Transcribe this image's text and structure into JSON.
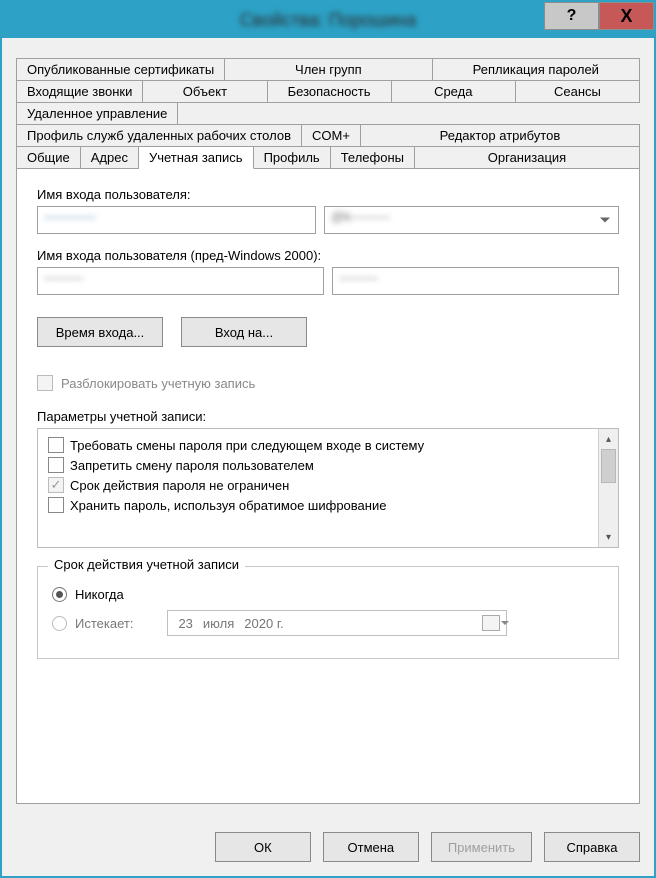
{
  "titlebar": {
    "title": "Свойства: Порошина",
    "help": "?",
    "close": "X"
  },
  "tabs": {
    "row1": [
      "Опубликованные сертификаты",
      "Член групп",
      "Репликация паролей"
    ],
    "row2": [
      "Входящие звонки",
      "Объект",
      "Безопасность",
      "Среда",
      "Сеансы"
    ],
    "row3": [
      "Удаленное управление"
    ],
    "row4": [
      "Профиль служб удаленных рабочих столов",
      "COM+",
      "Редактор атрибутов"
    ],
    "row5": [
      "Общие",
      "Адрес",
      "Учетная запись",
      "Профиль",
      "Телефоны",
      "Организация"
    ],
    "active": "Учетная запись"
  },
  "account": {
    "logon_label": "Имя входа пользователя:",
    "logon_value": "————",
    "domain_value": "@k———",
    "prewin_label": "Имя входа пользователя (пред-Windows 2000):",
    "prewin_domain": "———",
    "prewin_user": "———",
    "logon_hours_btn": "Время входа...",
    "log_on_to_btn": "Вход на...",
    "unlock_label": "Разблокировать учетную запись",
    "options_label": "Параметры учетной записи:",
    "options": [
      {
        "label": "Требовать смены пароля при следующем входе в систему",
        "checked": false
      },
      {
        "label": "Запретить смену пароля пользователем",
        "checked": false
      },
      {
        "label": "Срок действия пароля не ограничен",
        "checked": true
      },
      {
        "label": "Хранить пароль, используя обратимое шифрование",
        "checked": false
      }
    ],
    "expiry": {
      "legend": "Срок действия учетной записи",
      "never": "Никогда",
      "expires_label": "Истекает:",
      "date_day": "23",
      "date_month": "июля",
      "date_year": "2020 г."
    }
  },
  "footer": {
    "ok": "ОК",
    "cancel": "Отмена",
    "apply": "Применить",
    "help": "Справка"
  }
}
